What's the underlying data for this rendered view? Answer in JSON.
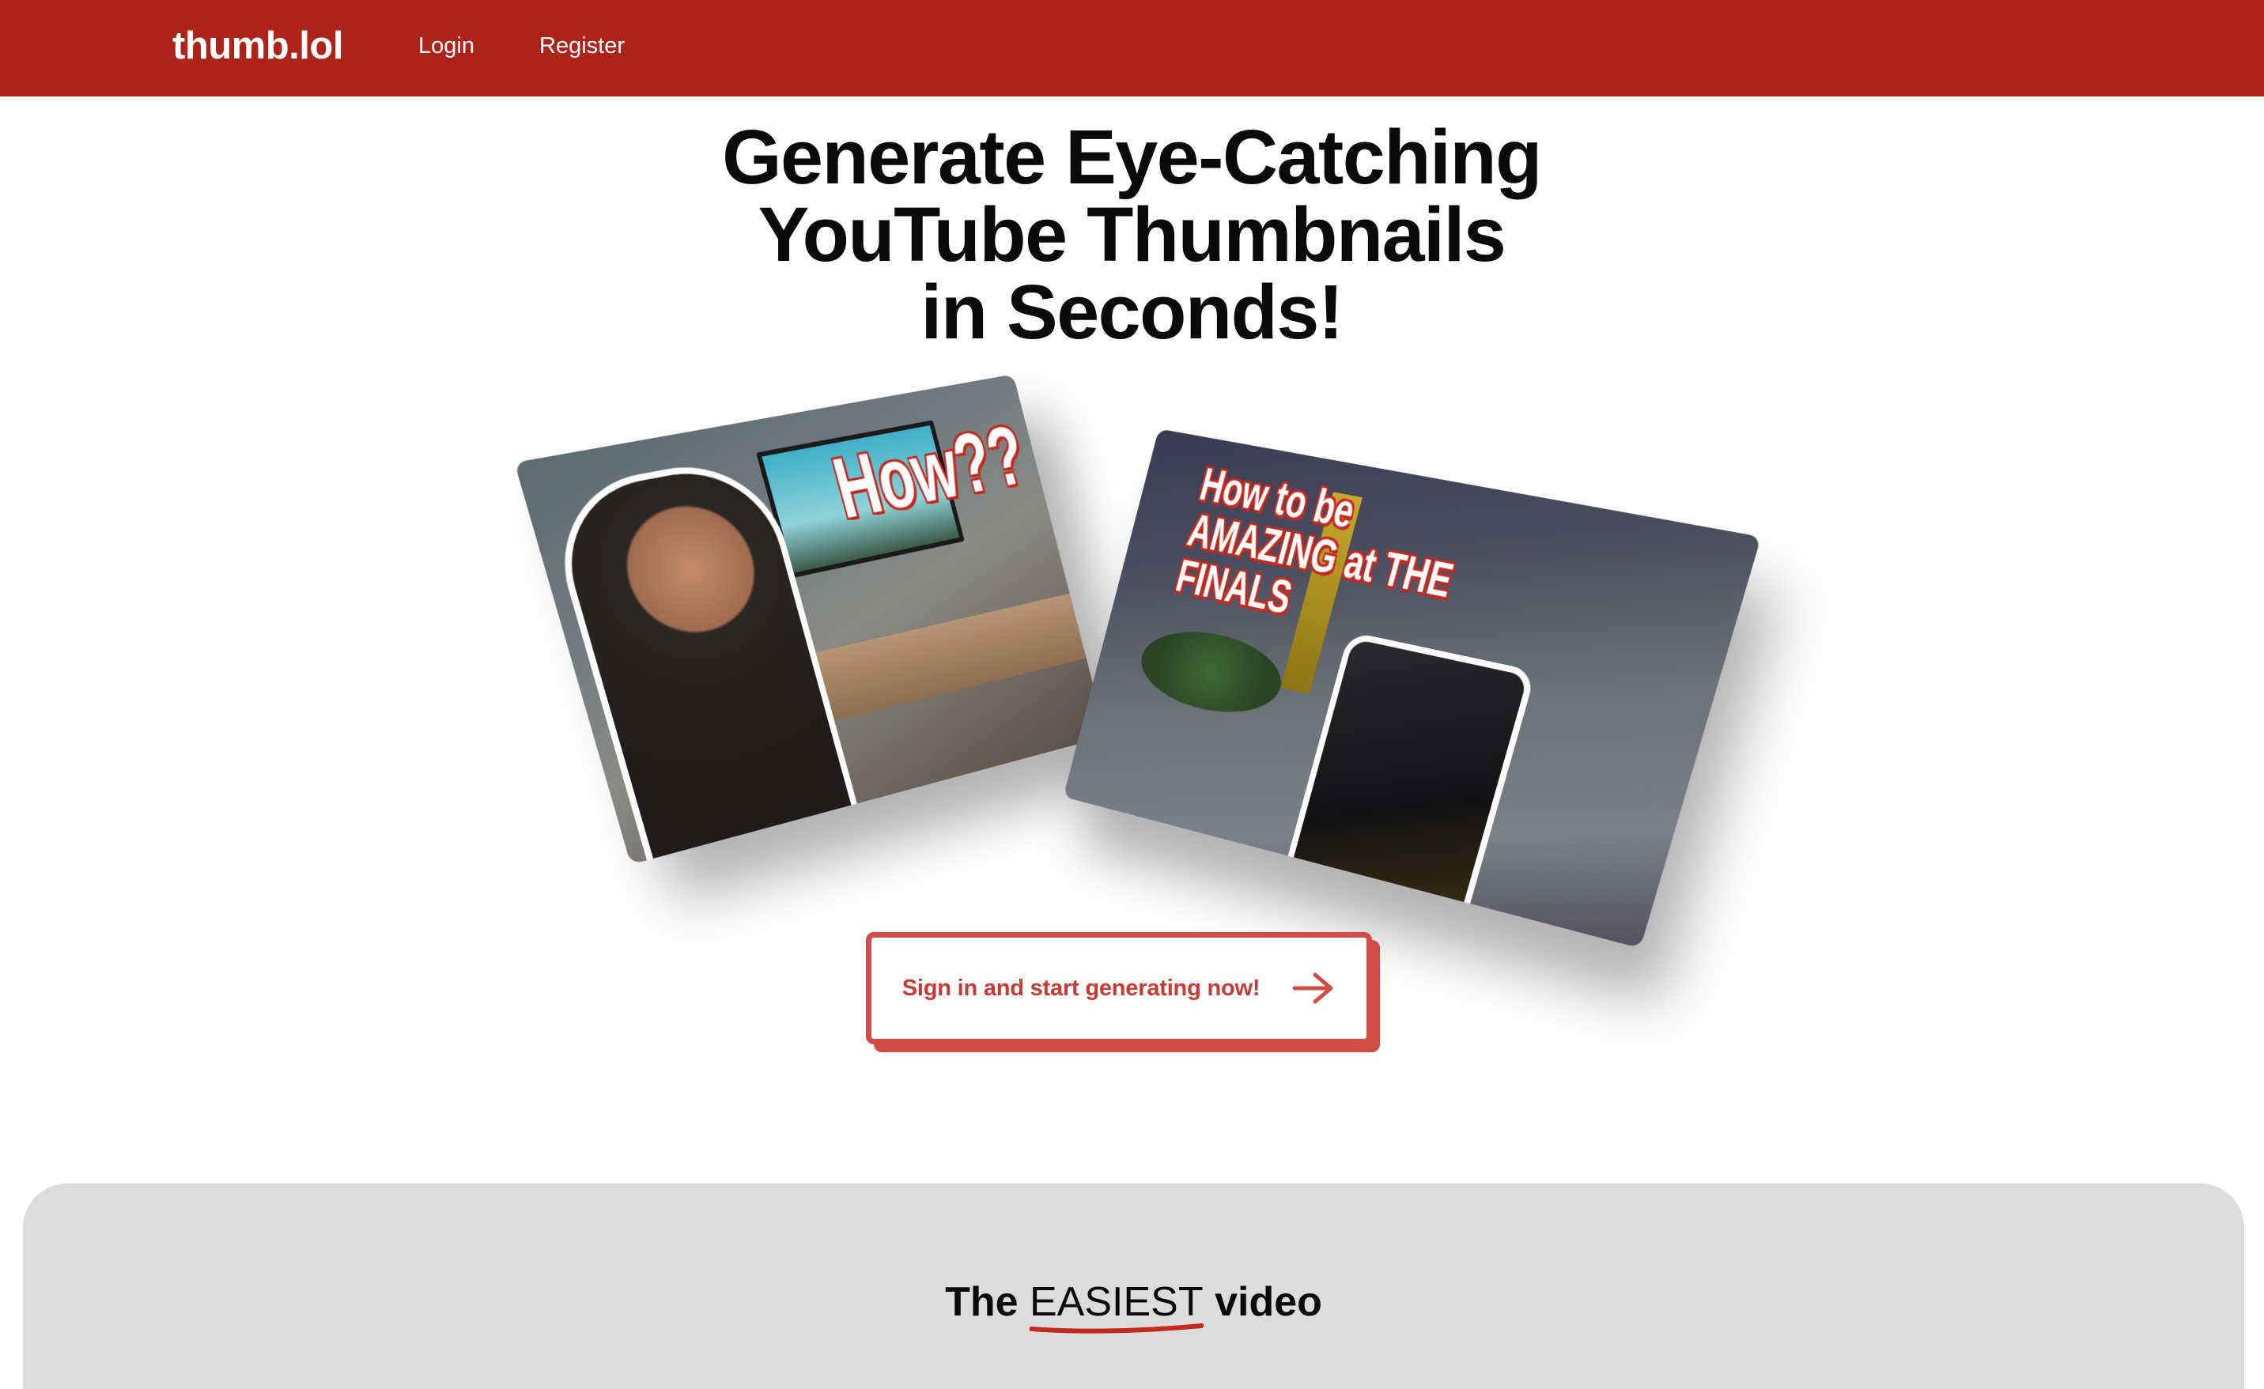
{
  "nav": {
    "brand": "thumb.lol",
    "login": "Login",
    "register": "Register"
  },
  "hero": {
    "title_lines": [
      "Generate Eye-Catching",
      "YouTube Thumbnails",
      "in Seconds!"
    ]
  },
  "thumbnails": [
    {
      "overlay_text": "How??",
      "description_icon": "person-at-desk-thumbnail"
    },
    {
      "overlay_lines": [
        "How to be",
        "AMAZING at THE",
        "FINALS"
      ],
      "description_icon": "fps-game-thumbnail"
    }
  ],
  "cta": {
    "label": "Sign in and start generating now!",
    "icon": "arrow-right-icon"
  },
  "feature": {
    "heading_pre": "The ",
    "heading_highlight": "EASIEST",
    "heading_post": " video"
  },
  "colors": {
    "navbar": "#ad2219",
    "cta_accent": "#d14c46",
    "section_bg": "#dcdcdc"
  }
}
